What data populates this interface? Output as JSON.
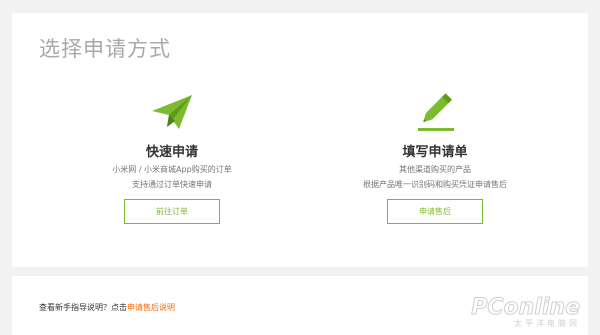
{
  "page": {
    "title": "选择申请方式"
  },
  "options": [
    {
      "title": "快速申请",
      "desc_line1": "小米网 / 小米商城App购买的订单",
      "desc_line2": "支持通过订单快速申请",
      "button_label": "前往订单",
      "icon": "paper-plane-icon"
    },
    {
      "title": "填写申请单",
      "desc_line1": "其他渠道购买的产品",
      "desc_line2": "根据产品唯一识别码和购买凭证申请售后",
      "button_label": "申请售后",
      "icon": "pencil-icon"
    }
  ],
  "footer": {
    "text": "查看新手指导说明？点击",
    "link_label": "申请售后说明"
  },
  "watermark": {
    "logo": "PConline",
    "sub": "太平洋电脑网"
  },
  "colors": {
    "accent": "#7dbb2e",
    "link": "#ff6700",
    "title_gray": "#a8a8a8",
    "background": "#f2f2f2"
  }
}
